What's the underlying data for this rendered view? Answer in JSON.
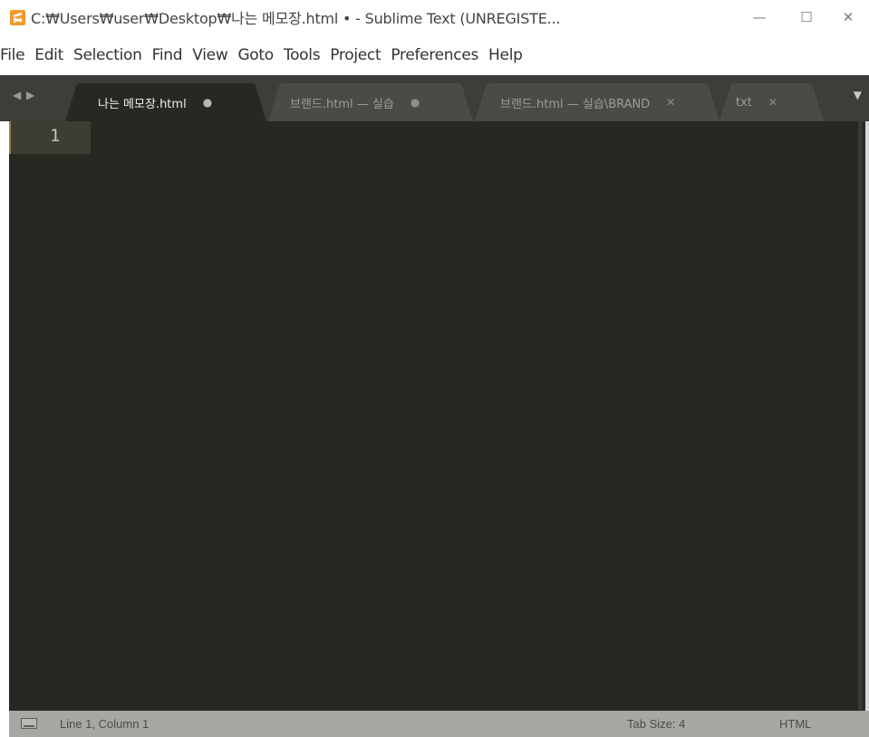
{
  "window": {
    "title": "C:₩Users₩user₩Desktop₩나는 메모장.html • - Sublime Text (UNREGISTE...",
    "app_icon": "sublime-text-icon",
    "controls": {
      "minimize": "—",
      "maximize": "☐",
      "close": "✕"
    }
  },
  "menu": {
    "items": [
      "File",
      "Edit",
      "Selection",
      "Find",
      "View",
      "Goto",
      "Tools",
      "Project",
      "Preferences",
      "Help"
    ]
  },
  "tabs": {
    "nav_arrows": "◀ ▶",
    "items": [
      {
        "label": "나는 메모장.html",
        "mark": "●",
        "active": true
      },
      {
        "label": "브랜드.html — 실습",
        "mark": "●",
        "active": false
      },
      {
        "label": "브랜드.html — 실습\\BRAND",
        "mark": "✕",
        "active": false
      },
      {
        "label": "txt",
        "mark": "✕",
        "active": false
      }
    ],
    "dropdown": "▼"
  },
  "editor": {
    "line_numbers": [
      "1"
    ],
    "lines": [
      ""
    ],
    "background": "#272822",
    "gutter_highlight": "#3e3d32"
  },
  "status": {
    "position": "Line 1, Column 1",
    "tab_size": "Tab Size: 4",
    "syntax": "HTML",
    "background": "#a7a8a4"
  },
  "colors": {
    "tab_strip": "#3d3e3a",
    "app_icon": "#f09a2c"
  }
}
